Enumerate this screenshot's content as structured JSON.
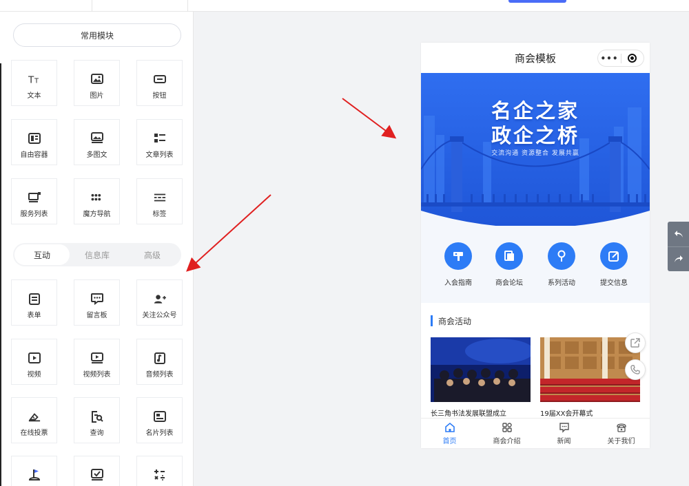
{
  "panel": {
    "common_section_label": "常用模块",
    "common_tiles": [
      {
        "label": "文本",
        "icon": "text-icon"
      },
      {
        "label": "图片",
        "icon": "image-icon"
      },
      {
        "label": "按钮",
        "icon": "button-icon"
      },
      {
        "label": "自由容器",
        "icon": "container-icon"
      },
      {
        "label": "多图文",
        "icon": "multi-image-text-icon"
      },
      {
        "label": "文章列表",
        "icon": "article-list-icon"
      },
      {
        "label": "服务列表",
        "icon": "service-list-icon"
      },
      {
        "label": "魔方导航",
        "icon": "cube-nav-icon"
      },
      {
        "label": "标签",
        "icon": "tag-icon"
      }
    ],
    "tabs": [
      {
        "label": "互动",
        "active": true
      },
      {
        "label": "信息库",
        "active": false
      },
      {
        "label": "高级",
        "active": false
      }
    ],
    "interactive_tiles": [
      {
        "label": "表单",
        "icon": "form-icon"
      },
      {
        "label": "留言板",
        "icon": "message-board-icon"
      },
      {
        "label": "关注公众号",
        "icon": "follow-account-icon"
      },
      {
        "label": "视频",
        "icon": "video-icon"
      },
      {
        "label": "视频列表",
        "icon": "video-list-icon"
      },
      {
        "label": "音频列表",
        "icon": "audio-list-icon"
      },
      {
        "label": "在线投票",
        "icon": "vote-icon"
      },
      {
        "label": "查询",
        "icon": "query-icon"
      },
      {
        "label": "名片列表",
        "icon": "card-list-icon"
      },
      {
        "label": "",
        "icon": "flag-icon"
      },
      {
        "label": "",
        "icon": "checkbox-icon"
      },
      {
        "label": "",
        "icon": "calculator-icon"
      }
    ]
  },
  "phone": {
    "title": "商会模板",
    "capsule_dots": "•••",
    "banner": {
      "line1": "名企之家",
      "line2": "政企之桥",
      "subtitle": "交流沟通  资源整合  发展共赢"
    },
    "nav_items": [
      {
        "label": "入会指南",
        "icon": "guide-icon"
      },
      {
        "label": "商会论坛",
        "icon": "forum-icon"
      },
      {
        "label": "系列活动",
        "icon": "activity-icon"
      },
      {
        "label": "提交信息",
        "icon": "edit-icon"
      }
    ],
    "section_title": "商会活动",
    "cards": [
      {
        "caption": "长三角书法发展联盟成立"
      },
      {
        "caption": "19届XX会开幕式"
      }
    ],
    "tabbar": [
      {
        "label": "首页",
        "active": true,
        "icon": "home-icon"
      },
      {
        "label": "商会介绍",
        "active": false,
        "icon": "grid-icon"
      },
      {
        "label": "新闻",
        "active": false,
        "icon": "news-icon"
      },
      {
        "label": "关于我们",
        "active": false,
        "icon": "phone-icon"
      }
    ]
  },
  "colors": {
    "accent": "#2d7cf6",
    "banner_top": "#2f6ef0",
    "banner_bottom": "#1f56d8",
    "undo_bg": "#6f7783"
  }
}
